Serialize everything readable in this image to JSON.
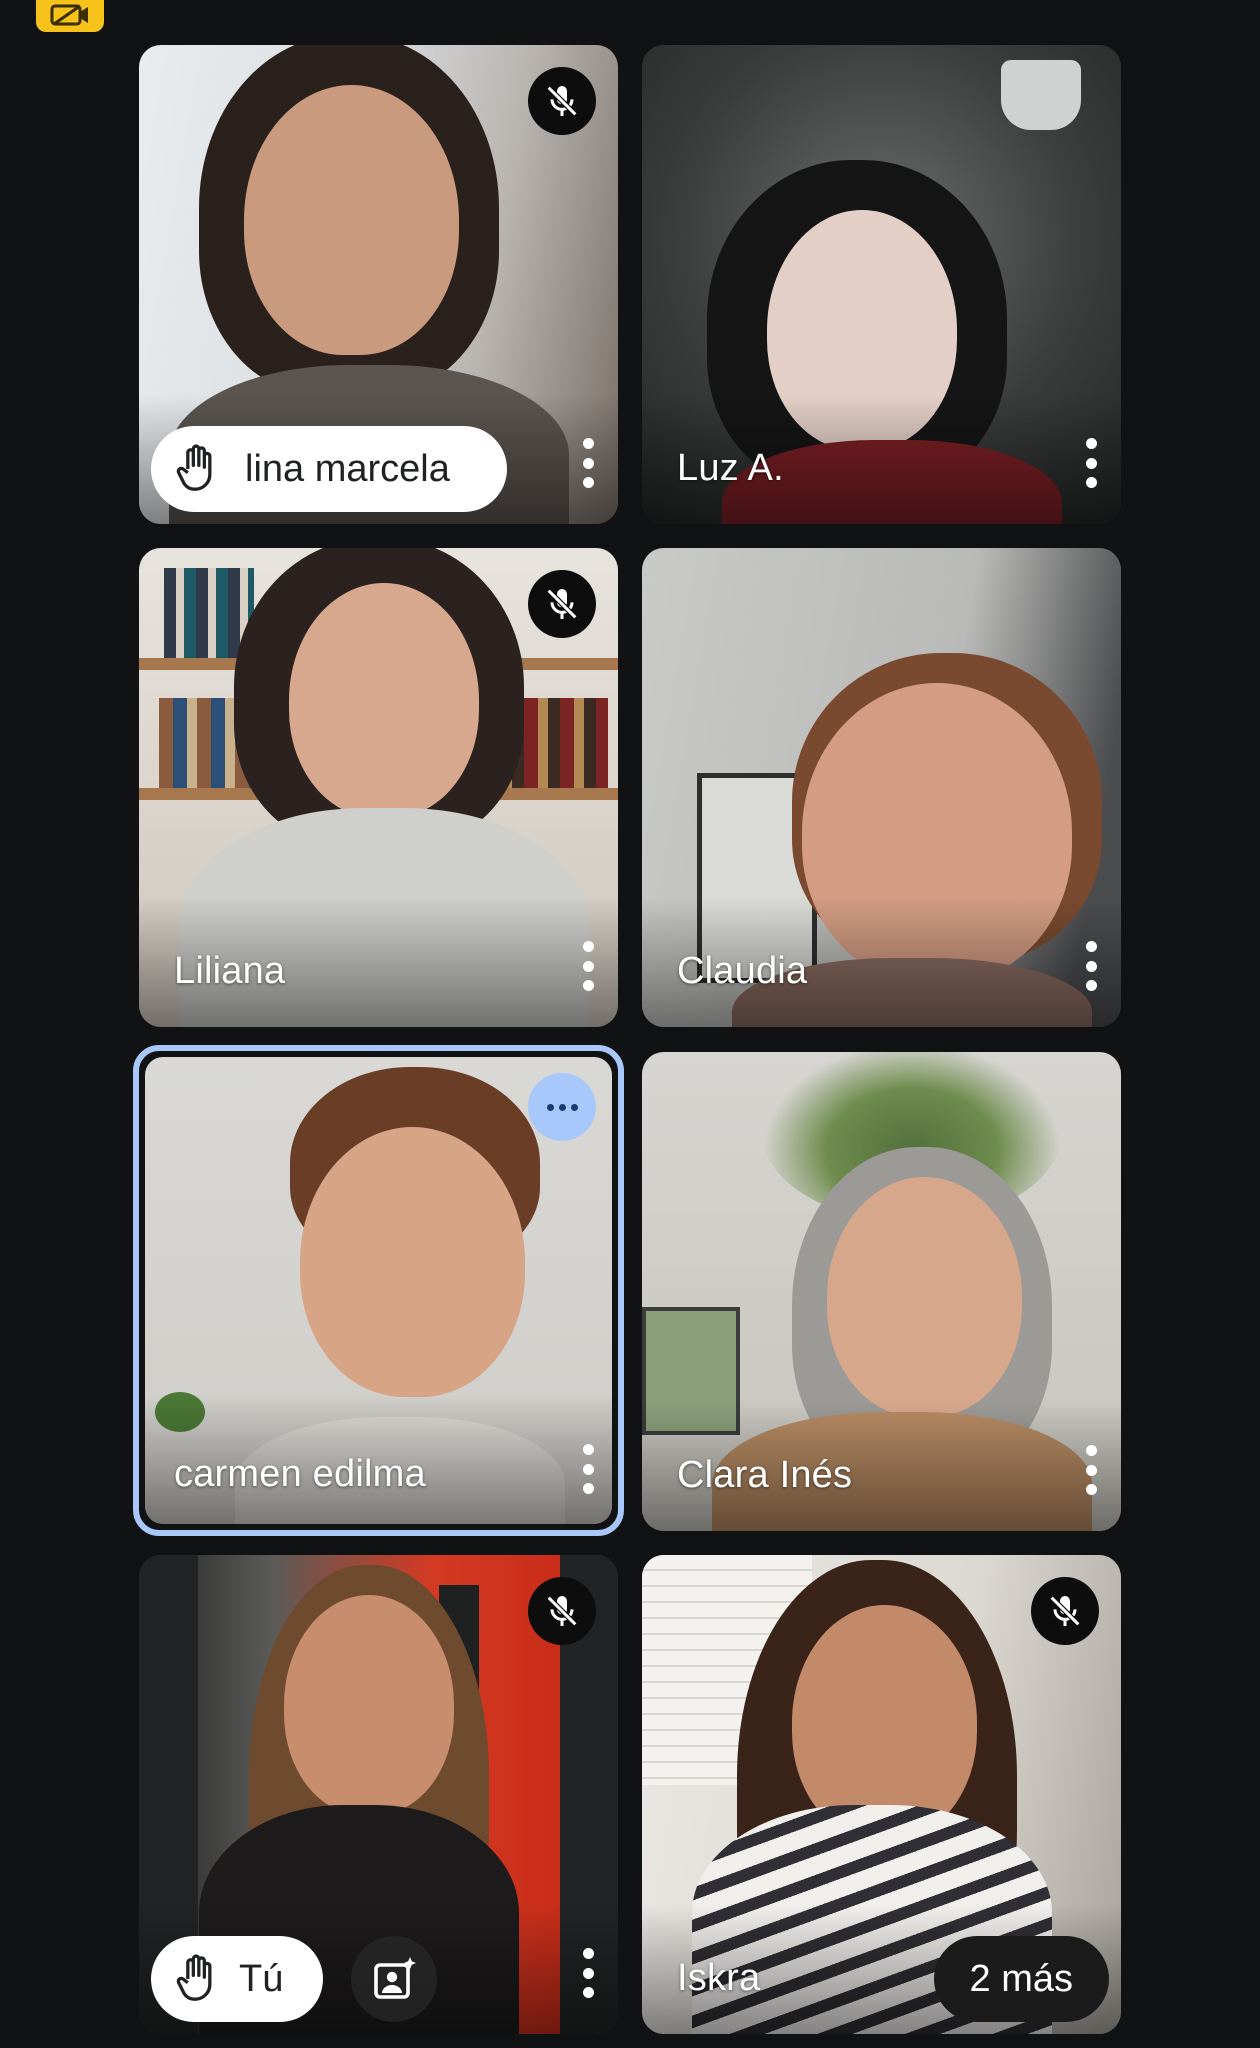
{
  "theme": {
    "background": "#111213",
    "selected_outline": "#a8c7fa",
    "warning_badge": "#f7c21a"
  },
  "top_badge": {
    "icon": "camera-off-icon"
  },
  "participants": [
    {
      "name": "lina marcela",
      "muted": true,
      "hand_raised": true
    },
    {
      "name": "Luz A.",
      "muted": false,
      "hand_raised": false
    },
    {
      "name": "Liliana",
      "muted": true,
      "hand_raised": false
    },
    {
      "name": "Claudia",
      "muted": false,
      "hand_raised": false
    },
    {
      "name": "carmen edilma",
      "muted": false,
      "speaking": true,
      "selected": true
    },
    {
      "name": "Clara Inés",
      "muted": false,
      "hand_raised": false
    },
    {
      "name": "Tú",
      "muted": true,
      "hand_raised": true
    },
    {
      "name": "Iskra",
      "muted": true,
      "hand_raised": false
    }
  ],
  "overflow": {
    "label": "2 más"
  },
  "icons": {
    "mute": "mic-off-icon",
    "more": "more-vert-icon",
    "hand": "raise-hand-icon",
    "effects": "visual-effects-icon",
    "speaking": "speaking-dots-icon"
  }
}
